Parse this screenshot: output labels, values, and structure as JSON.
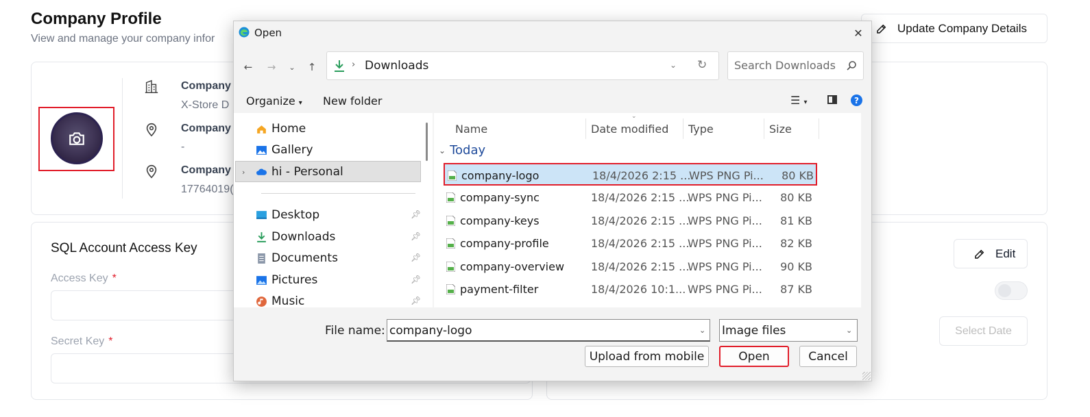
{
  "page": {
    "title": "Company Profile",
    "subtitle": "View and manage your company infor",
    "update_button": "Update Company Details",
    "info": [
      {
        "label": "Company",
        "value": "X-Store D",
        "icon": "building-icon"
      },
      {
        "label": "Company",
        "value": "-",
        "icon": "map-pin-icon"
      },
      {
        "label": "Company",
        "value": "17764019(",
        "icon": "map-pin-icon"
      }
    ],
    "sql": {
      "title": "SQL Account Access Key",
      "access_key_label": "Access Key",
      "secret_key_label": "Secret Key",
      "required_mark": "*"
    },
    "edit_button": "Edit",
    "select_date_button": "Select Date"
  },
  "dialog": {
    "title": "Open",
    "address": "Downloads",
    "search_placeholder": "Search Downloads",
    "toolbar": {
      "organize": "Organize",
      "new_folder": "New folder"
    },
    "nav": [
      {
        "label": "Home",
        "icon": "home-icon"
      },
      {
        "label": "Gallery",
        "icon": "gallery-icon"
      },
      {
        "label": "hi - Personal",
        "icon": "cloud-icon"
      },
      {
        "label": "Desktop",
        "icon": "desktop-icon"
      },
      {
        "label": "Downloads",
        "icon": "download-icon"
      },
      {
        "label": "Documents",
        "icon": "document-icon"
      },
      {
        "label": "Pictures",
        "icon": "pictures-icon"
      },
      {
        "label": "Music",
        "icon": "music-icon"
      }
    ],
    "columns": {
      "name": "Name",
      "date": "Date modified",
      "type": "Type",
      "size": "Size"
    },
    "group": "Today",
    "files": [
      {
        "name": "company-logo",
        "date": "18/4/2026 2:15 ...",
        "type": "WPS PNG Pi...",
        "size": "80 KB"
      },
      {
        "name": "company-sync",
        "date": "18/4/2026 2:15 ...",
        "type": "WPS PNG Pi...",
        "size": "80 KB"
      },
      {
        "name": "company-keys",
        "date": "18/4/2026 2:15 ...",
        "type": "WPS PNG Pi...",
        "size": "81 KB"
      },
      {
        "name": "company-profile",
        "date": "18/4/2026 2:15 ...",
        "type": "WPS PNG Pi...",
        "size": "82 KB"
      },
      {
        "name": "company-overview",
        "date": "18/4/2026 2:15 ...",
        "type": "WPS PNG Pi...",
        "size": "90 KB"
      },
      {
        "name": "payment-filter",
        "date": "18/4/2026 10:1...",
        "type": "WPS PNG Pi...",
        "size": "87 KB"
      }
    ],
    "file_name_label": "File name:",
    "file_name_value": "company-logo",
    "file_type": "Image files",
    "buttons": {
      "upload": "Upload from mobile",
      "open": "Open",
      "cancel": "Cancel"
    }
  },
  "colors": {
    "highlight_red": "#e11d2a",
    "selection_blue": "#cce4f7",
    "accent_blue": "#1a73e8"
  }
}
